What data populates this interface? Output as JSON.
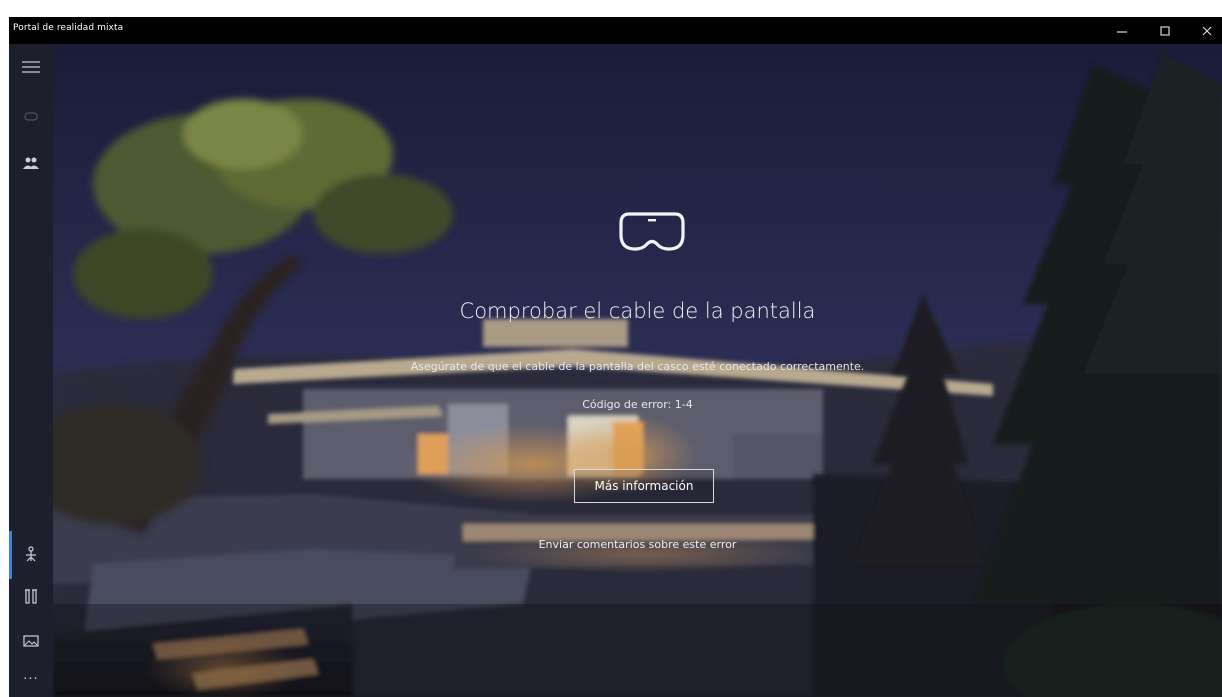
{
  "window": {
    "title": "Portal de realidad mixta",
    "controls": {
      "minimize": "—",
      "maximize": "☐",
      "close": "✕"
    }
  },
  "sidebar": {
    "menu_icon": "hamburger-menu-icon",
    "items": [
      {
        "icon": "headset-icon"
      },
      {
        "icon": "people-icon"
      },
      {
        "icon": "mixed-reality-icon",
        "active": true
      },
      {
        "icon": "controllers-icon"
      },
      {
        "icon": "photos-icon"
      },
      {
        "icon": "more-icon",
        "label": "···"
      }
    ],
    "accent": "#3a86d6"
  },
  "main": {
    "icon": "headset-outline-icon",
    "headline": "Comprobar el cable de la pantalla",
    "description": "Asegúrate de que el cable de la pantalla del casco esté conectado correctamente.",
    "error_code": "Código de error: 1-4",
    "more_info_button": "Más información",
    "feedback_link": "Enviar comentarios sobre este error"
  }
}
